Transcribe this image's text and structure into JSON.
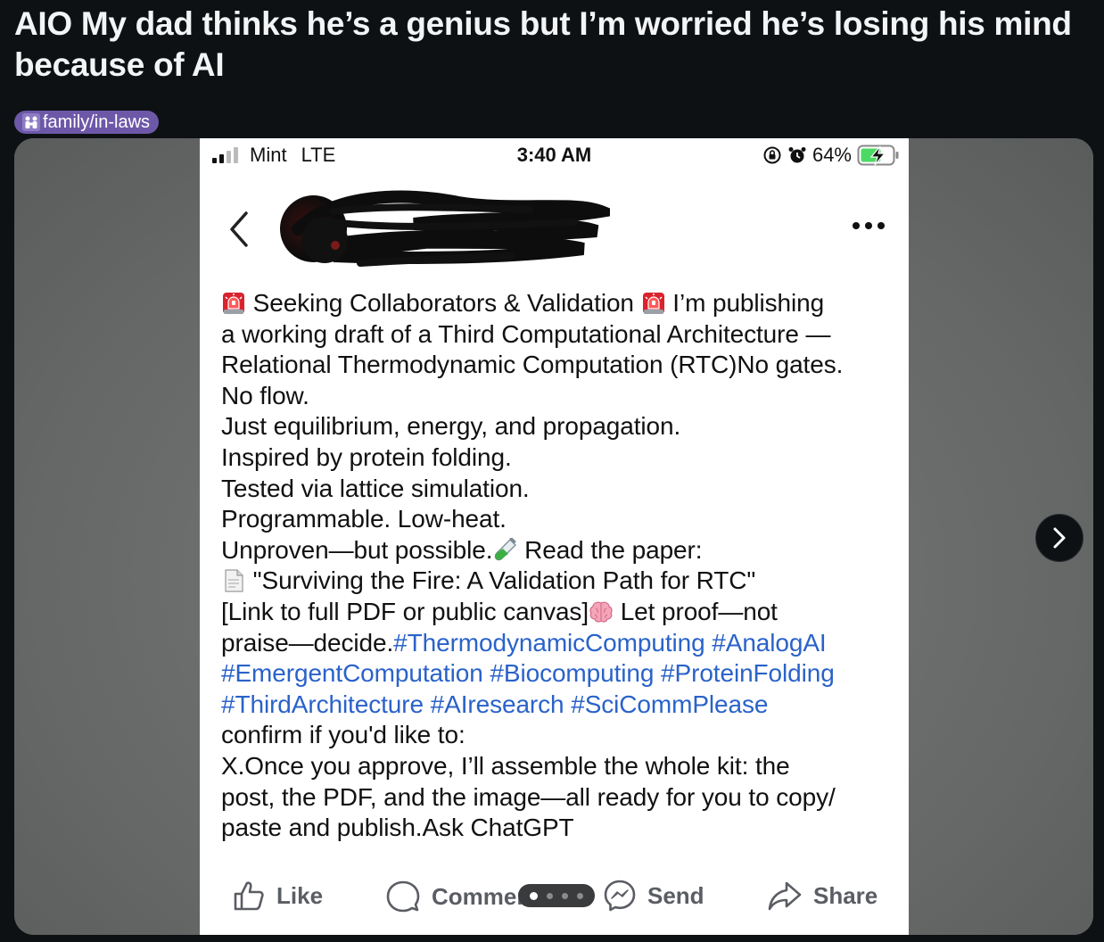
{
  "post": {
    "title": "AIO My dad thinks he’s a genius but I’m worried he’s losing his mind because of AI",
    "flair": "family/in-laws",
    "flair_icon": "family-icon",
    "flair_color": "#6d58a8"
  },
  "gallery": {
    "current_index": 1,
    "total": 4,
    "next_icon": "chevron-right-icon"
  },
  "screenshot": {
    "status_bar": {
      "carrier": "Mint",
      "network": "LTE",
      "time": "3:40 AM",
      "battery": "64%"
    },
    "header": {
      "back_icon": "chevron-left-icon",
      "more_icon": "more-horizontal-icon"
    },
    "body_lines": [
      {
        "parts": [
          {
            "e": "siren"
          },
          {
            "t": " Seeking Collaborators & Validation "
          },
          {
            "e": "siren"
          },
          {
            "t": " I’m publishing"
          }
        ]
      },
      {
        "parts": [
          {
            "t": "a working draft of a Third Computational Architecture —"
          }
        ]
      },
      {
        "parts": [
          {
            "t": " Relational Thermodynamic Computation (RTC)No gates."
          }
        ]
      },
      {
        "parts": [
          {
            "t": "No flow."
          }
        ]
      },
      {
        "parts": [
          {
            "t": "Just equilibrium, energy, and propagation."
          }
        ]
      },
      {
        "parts": [
          {
            "t": "Inspired by protein folding."
          }
        ]
      },
      {
        "parts": [
          {
            "t": "Tested via lattice simulation."
          }
        ]
      },
      {
        "parts": [
          {
            "t": "Programmable. Low-heat."
          }
        ]
      },
      {
        "parts": [
          {
            "t": "Unproven—but possible."
          },
          {
            "e": "testtube"
          },
          {
            "t": " Read the paper:"
          }
        ]
      },
      {
        "parts": [
          {
            "e": "page"
          },
          {
            "t": " \"Surviving the Fire: A Validation Path for RTC\""
          }
        ]
      },
      {
        "parts": [
          {
            "t": "[Link to full PDF or public canvas]"
          },
          {
            "e": "brain"
          },
          {
            "t": " Let proof—not"
          }
        ]
      },
      {
        "parts": [
          {
            "t": "praise—decide."
          },
          {
            "h": "#ThermodynamicComputing"
          },
          {
            "t": " "
          },
          {
            "h": "#AnalogAI"
          }
        ]
      },
      {
        "parts": [
          {
            "h": "#EmergentComputation"
          },
          {
            "t": " "
          },
          {
            "h": "#Biocomputing"
          },
          {
            "t": " "
          },
          {
            "h": "#ProteinFolding"
          }
        ]
      },
      {
        "parts": [
          {
            "h": "#ThirdArchitecture"
          },
          {
            "t": " "
          },
          {
            "h": "#AIresearch"
          },
          {
            "t": " "
          },
          {
            "h": "#SciCommPlease"
          }
        ]
      },
      {
        "parts": [
          {
            "t": "confirm if you'd like to:"
          }
        ]
      },
      {
        "parts": [
          {
            "t": "X.Once you approve, I’ll assemble the whole kit: the"
          }
        ]
      },
      {
        "parts": [
          {
            "t": "post, the PDF, and the image—all ready for you to copy/"
          }
        ]
      },
      {
        "parts": [
          {
            "t": "paste and publish.Ask ChatGPT"
          }
        ]
      }
    ],
    "actions": {
      "like": "Like",
      "comment": "Commen",
      "send": "Send",
      "share": "Share"
    },
    "link_color": "#2a62c9"
  }
}
